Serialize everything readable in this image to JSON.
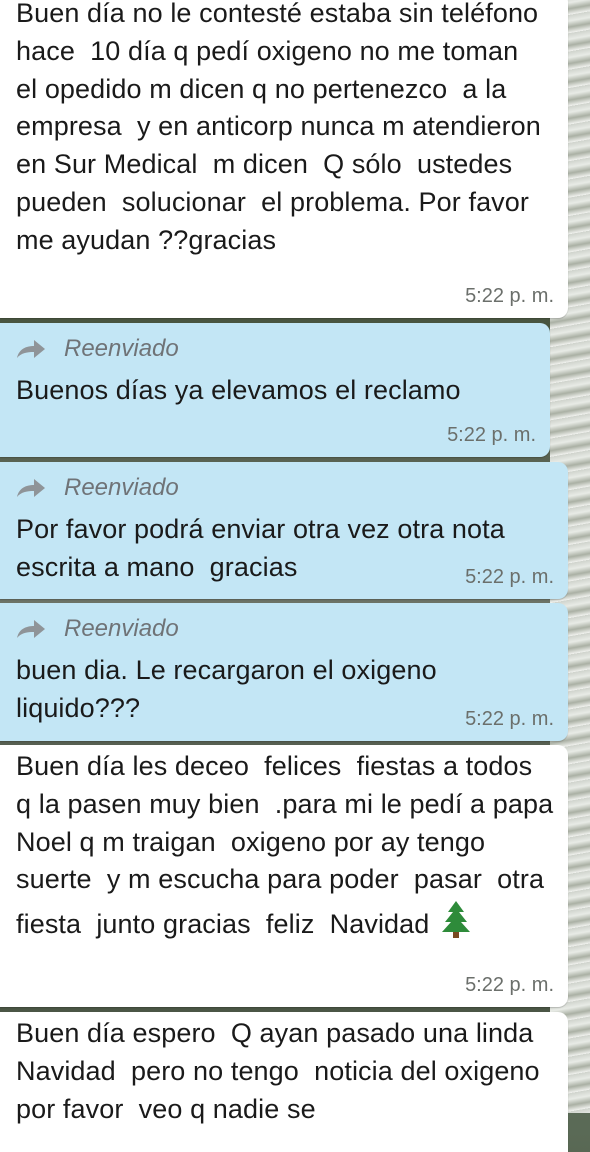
{
  "messages": [
    {
      "type": "incoming",
      "text": "Buen día no le contesté estaba sin teléfono  hace  10 día q pedí oxigeno no me toman  el opedido m dicen q no pertenezco  a la empresa  y en anticorp nunca m atendieron en Sur Medical  m dicen  Q sólo  ustedes pueden  solucionar  el problema. Por favor me ayudan ??gracias",
      "time": "5:22 p. m."
    },
    {
      "type": "outgoing",
      "forwarded_label": "Reenviado",
      "text": "Buenos días ya elevamos el reclamo",
      "time": "5:22 p. m."
    },
    {
      "type": "outgoing",
      "forwarded_label": "Reenviado",
      "text": "Por favor podrá enviar otra vez otra nota escrita a mano  gracias",
      "time": "5:22 p. m."
    },
    {
      "type": "outgoing",
      "forwarded_label": "Reenviado",
      "text": "buen dia. Le recargaron el oxigeno liquido???",
      "time": "5:22 p. m."
    },
    {
      "type": "incoming",
      "text": "Buen día les deceo  felices  fiestas a todos q la pasen muy bien  .para mi le pedí a papa Noel q m traigan  oxigeno por ay tengo  suerte  y m escucha para poder  pasar  otra fiesta  junto gracias  feliz  Navidad",
      "emoji": "christmas-tree",
      "time": "5:22 p. m."
    },
    {
      "type": "incoming",
      "text": "Buen día espero  Q ayan pasado una linda Navidad  pero no tengo  noticia del oxigeno por favor  veo q nadie se"
    }
  ]
}
